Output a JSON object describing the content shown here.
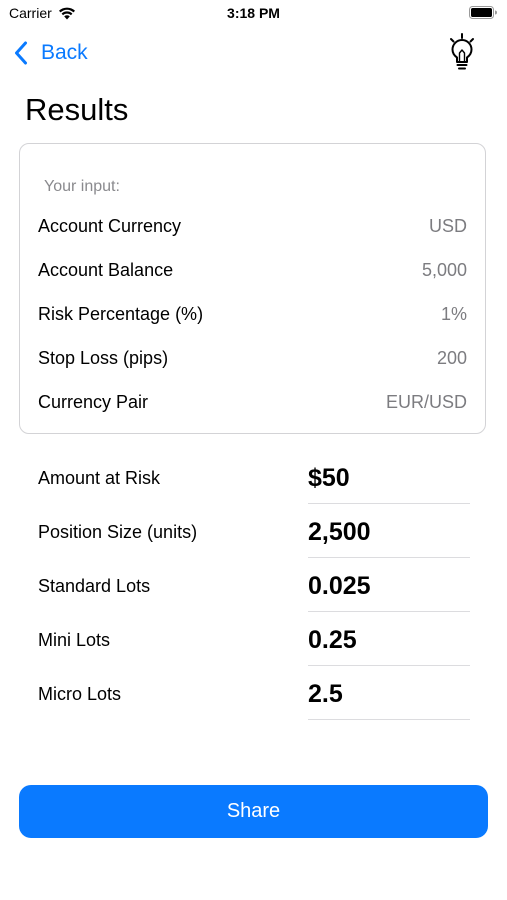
{
  "status_bar": {
    "carrier": "Carrier",
    "time": "3:18 PM"
  },
  "nav": {
    "back_label": "Back",
    "accent_color": "#0a7aff",
    "right_icon": "lightbulb-icon"
  },
  "title": "Results",
  "input_card": {
    "header": "Your input:",
    "rows": [
      {
        "label": "Account Currency",
        "value": "USD"
      },
      {
        "label": "Account Balance",
        "value": "5,000"
      },
      {
        "label": "Risk Percentage (%)",
        "value": "1%"
      },
      {
        "label": "Stop Loss (pips)",
        "value": "200"
      },
      {
        "label": "Currency Pair",
        "value": "EUR/USD"
      }
    ]
  },
  "results": [
    {
      "label": "Amount at Risk",
      "value": "$50"
    },
    {
      "label": "Position Size (units)",
      "value": "2,500"
    },
    {
      "label": "Standard Lots",
      "value": "0.025"
    },
    {
      "label": "Mini Lots",
      "value": "0.25"
    },
    {
      "label": "Micro Lots",
      "value": "2.5"
    }
  ],
  "share_label": "Share"
}
